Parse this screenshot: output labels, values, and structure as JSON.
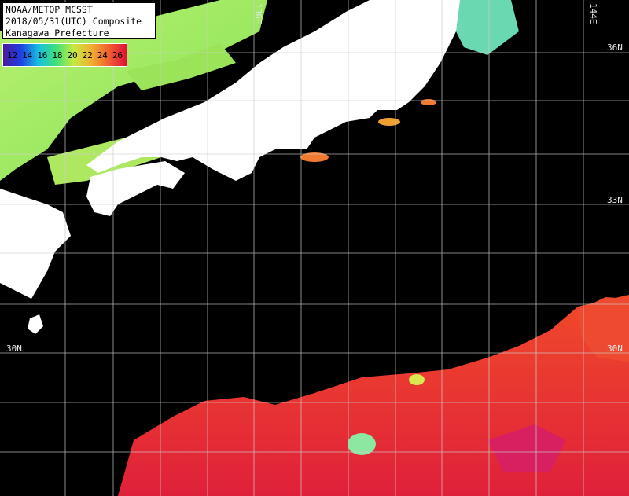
{
  "title": {
    "line1": "NOAA/METOP MCSST",
    "line2": "2018/05/31(UTC) Composite",
    "line3": "Kanagawa Prefecture"
  },
  "legend": {
    "labels": [
      "12",
      "14",
      "16",
      "18",
      "20",
      "22",
      "24",
      "26"
    ],
    "colors": [
      "#4a1aa0",
      "#1f3fe0",
      "#16c0e0",
      "#3ee07a",
      "#c6ea40",
      "#f0b030",
      "#f06030",
      "#e0103a"
    ]
  },
  "grid_labels": {
    "lon_136": "136E",
    "lon_144": "144E",
    "lat_36": "36N",
    "lat_33": "33N",
    "lat_30_left": "30N",
    "lat_30_right": "30N"
  },
  "colors": {
    "land": "#ffffff",
    "no_data": "#000000",
    "warm_sea": "#e83a28",
    "grid": "#cfcfcf"
  }
}
